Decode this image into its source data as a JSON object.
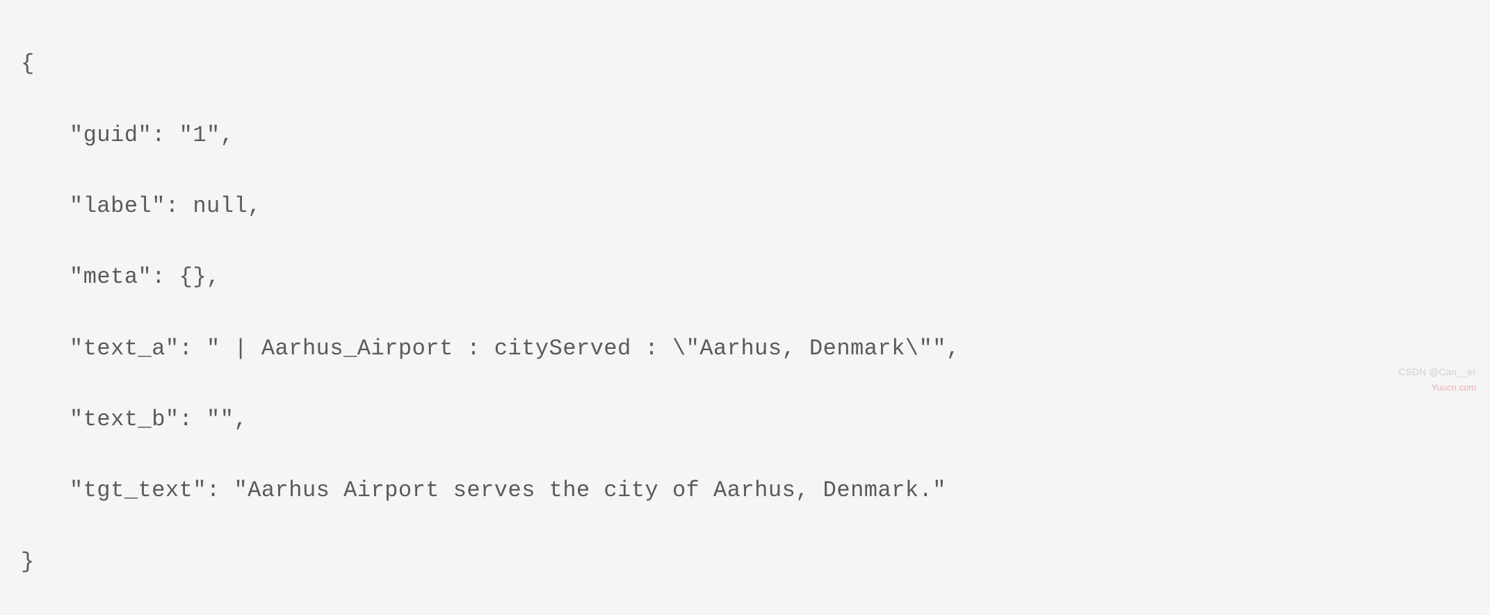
{
  "code": {
    "open_brace": "{",
    "line1_key": "\"guid\"",
    "line1_sep": ": ",
    "line1_val": "\"1\"",
    "line1_end": ",",
    "line2_key": "\"label\"",
    "line2_sep": ": ",
    "line2_val": "null",
    "line2_end": ",",
    "line3_key": "\"meta\"",
    "line3_sep": ": ",
    "line3_val": "{}",
    "line3_end": ",",
    "line4_key": "\"text_a\"",
    "line4_sep": ": ",
    "line4_val": "\" | Aarhus_Airport : cityServed : \\\"Aarhus, Denmark\\\"\"",
    "line4_end": ",",
    "line5_key": "\"text_b\"",
    "line5_sep": ": ",
    "line5_val": "\"\"",
    "line5_end": ",",
    "line6_key": "\"tgt_text\"",
    "line6_sep": ": ",
    "line6_val": "\"Aarhus Airport serves the city of Aarhus, Denmark.\"",
    "close_brace": "}"
  },
  "watermark": {
    "csdn": "CSDN @Can__er",
    "yuucn": "Yuucn.com"
  }
}
